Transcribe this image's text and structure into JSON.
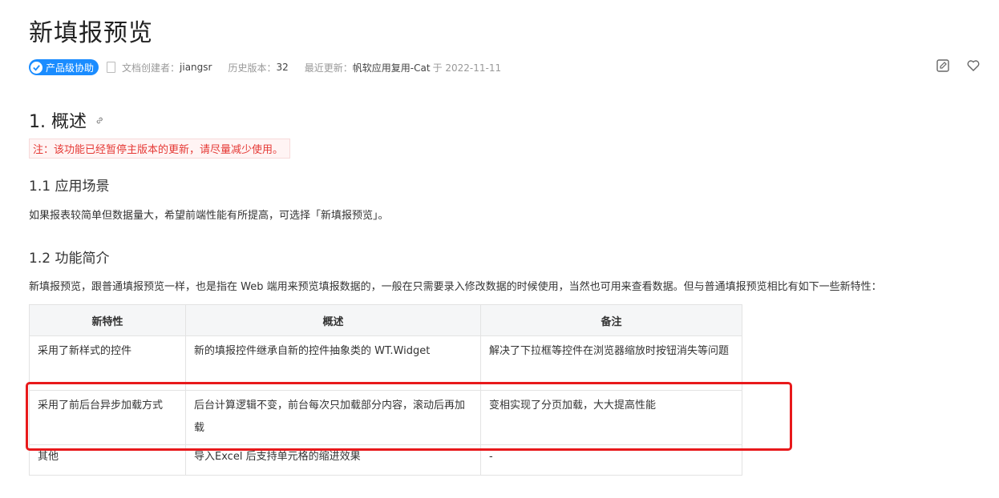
{
  "page": {
    "title": "新填报预览"
  },
  "meta": {
    "badge": "产品级协助",
    "creator_label": "文档创建者：",
    "creator": "jiangsr",
    "history_label": "历史版本：",
    "history": "32",
    "updated_label": "最近更新：",
    "updated_by": "帆软应用复用-Cat",
    "updated_on": "于 2022-11-11"
  },
  "icons": {
    "edit": "edit-icon",
    "like": "heart-icon",
    "anchor": "link-icon"
  },
  "section1": {
    "heading": "1. 概述",
    "note": "注：该功能已经暂停主版本的更新，请尽量减少使用。"
  },
  "section11": {
    "heading": "1.1 应用场景",
    "text": "如果报表较简单但数据量大，希望前端性能有所提高，可选择「新填报预览」。"
  },
  "section12": {
    "heading": "1.2 功能简介",
    "text": "新填报预览，跟普通填报预览一样，也是指在 Web 端用来预览填报数据的，一般在只需要录入修改数据的时候使用，当然也可用来查看数据。但与普通填报预览相比有如下一些新特性："
  },
  "table": {
    "headers": [
      "新特性",
      "概述",
      "备注"
    ],
    "rows": [
      [
        "采用了新样式的控件",
        "新的填报控件继承自新的控件抽象类的 WT.Widget",
        "解决了下拉框等控件在浏览器缩放时按钮消失等问题"
      ],
      [
        "采用了前后台异步加载方式",
        "后台计算逻辑不变，前台每次只加载部分内容，滚动后再加载",
        "变相实现了分页加载，大大提高性能"
      ],
      [
        "其他",
        "导入Excel 后支持单元格的缩进效果",
        "-"
      ]
    ]
  },
  "colors": {
    "accent": "#1a8cff",
    "warning": "#e53935",
    "highlight": "#e8191b"
  }
}
